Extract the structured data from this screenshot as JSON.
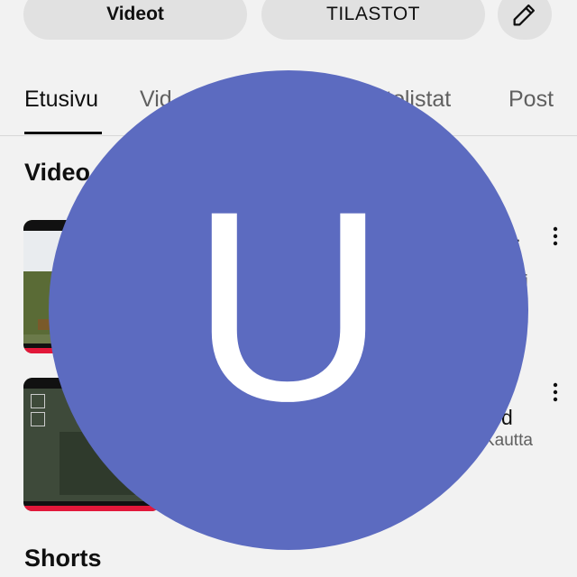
{
  "actions": {
    "videos_button": "Videot",
    "stats_button": "TILASTOT",
    "edit_icon": "pencil-icon"
  },
  "tabs": [
    {
      "label": "Etusivu",
      "active": true
    },
    {
      "label": "Vid"
    },
    {
      "label": "tolistat"
    },
    {
      "label": "Post"
    }
  ],
  "sections": {
    "videos_title": "Video",
    "shorts_title": "Shorts"
  },
  "videos": [
    {
      "title": "...",
      "meta": "si"
    },
    {
      "title": "d",
      "meta": "Kautta"
    }
  ],
  "avatar": {
    "letter": "U",
    "color": "#5c6bc0"
  }
}
